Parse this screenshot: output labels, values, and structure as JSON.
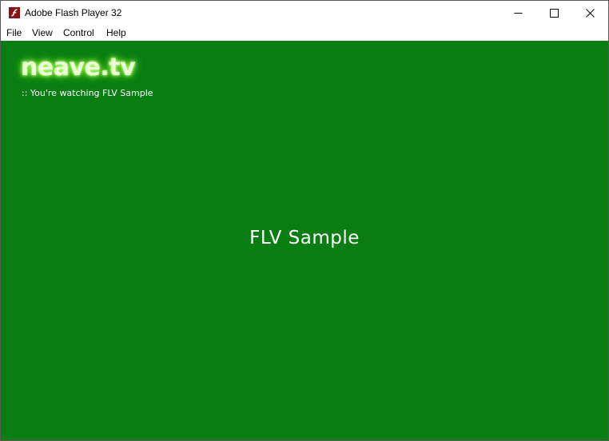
{
  "window": {
    "title": "Adobe Flash Player 32",
    "icon": "flash-player-icon",
    "controls": [
      "minimize-icon",
      "maximize-icon",
      "close-icon"
    ]
  },
  "menu": {
    "items": [
      {
        "label": "File"
      },
      {
        "label": "View"
      },
      {
        "label": "Control"
      },
      {
        "label": "Help"
      }
    ]
  },
  "stage": {
    "background": "#0a7d13",
    "logo_text": "neave.tv",
    "logo_color": "#eaffd8",
    "logo_glow": "#7dff1a",
    "status_text": ":: You're watching FLV Sample",
    "center_title": "FLV Sample"
  }
}
